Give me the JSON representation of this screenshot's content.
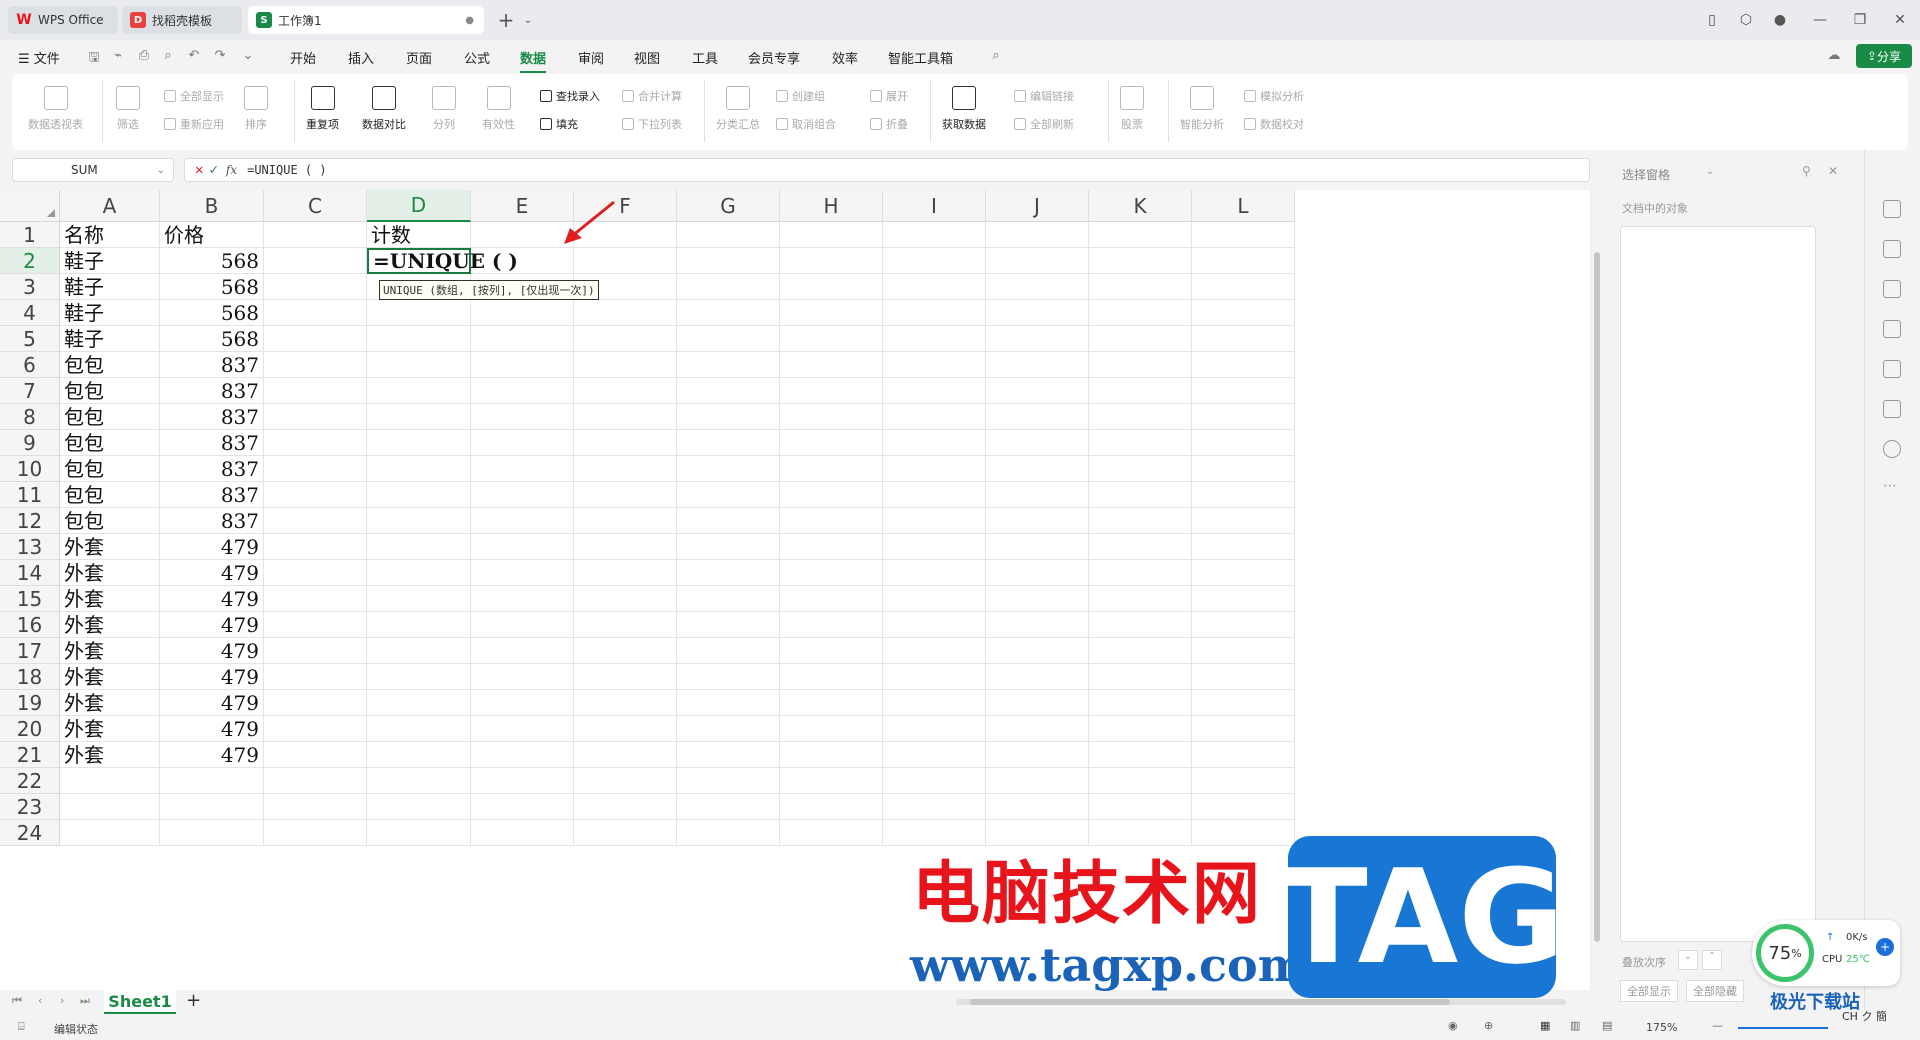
{
  "tabs": [
    {
      "label": "WPS Office",
      "icon": "wps-logo-icon",
      "color": "#e8141b"
    },
    {
      "label": "找稻壳模板",
      "icon": "docer-icon",
      "color": "#e8413f"
    },
    {
      "label": "工作簿1",
      "icon": "sheet-icon",
      "color": "#1a8b46"
    }
  ],
  "menu": {
    "file": "文件",
    "items": [
      "开始",
      "插入",
      "页面",
      "公式",
      "数据",
      "审阅",
      "视图",
      "工具",
      "会员专享",
      "效率",
      "智能工具箱"
    ],
    "active": "数据",
    "share": "分享"
  },
  "ribbon": {
    "pivot": "数据透视表",
    "filter": "筛选",
    "show_all": "全部显示",
    "reapply": "重新应用",
    "sort": "排序",
    "dup": "重复项",
    "compare": "数据对比",
    "split": "分列",
    "validity": "有效性",
    "lookup": "查找录入",
    "fill": "填充",
    "merge_calc": "合并计算",
    "dropdown": "下拉列表",
    "subtotal": "分类汇总",
    "group": "创建组",
    "ungroup": "取消组合",
    "expand": "展开",
    "collapse": "折叠",
    "get_data": "获取数据",
    "edit_links": "编辑链接",
    "refresh_all": "全部刷新",
    "stock": "股票",
    "smart": "智能分析",
    "simulate": "模拟分析",
    "verify": "数据校对"
  },
  "formula_bar": {
    "name_box": "SUM",
    "formula": "=UNIQUE ( )"
  },
  "grid": {
    "columns": [
      "A",
      "B",
      "C",
      "D",
      "E",
      "F",
      "G",
      "H",
      "I",
      "J",
      "K",
      "L"
    ],
    "selected_column": "D",
    "rows": [
      "1",
      "2",
      "3",
      "4",
      "5",
      "6",
      "7",
      "8",
      "9",
      "10",
      "11",
      "12",
      "13",
      "14",
      "15",
      "16",
      "17",
      "18",
      "19",
      "20",
      "21",
      "22",
      "23",
      "24"
    ],
    "selected_row": "2",
    "header": {
      "A": "名称",
      "B": "价格",
      "D": "计数"
    },
    "data": [
      [
        "鞋子",
        "568"
      ],
      [
        "鞋子",
        "568"
      ],
      [
        "鞋子",
        "568"
      ],
      [
        "鞋子",
        "568"
      ],
      [
        "包包",
        "837"
      ],
      [
        "包包",
        "837"
      ],
      [
        "包包",
        "837"
      ],
      [
        "包包",
        "837"
      ],
      [
        "包包",
        "837"
      ],
      [
        "包包",
        "837"
      ],
      [
        "包包",
        "837"
      ],
      [
        "外套",
        "479"
      ],
      [
        "外套",
        "479"
      ],
      [
        "外套",
        "479"
      ],
      [
        "外套",
        "479"
      ],
      [
        "外套",
        "479"
      ],
      [
        "外套",
        "479"
      ],
      [
        "外套",
        "479"
      ],
      [
        "外套",
        "479"
      ],
      [
        "外套",
        "479"
      ]
    ],
    "active_cell_text": "=UNIQUE ( )",
    "tooltip": "UNIQUE (数组, [按列], [仅出现一次])"
  },
  "sheets": {
    "tab": "Sheet1",
    "add": "+"
  },
  "status": {
    "mode": "编辑状态",
    "zoom": "175%"
  },
  "selection_pane": {
    "title": "选择窗格",
    "objects_label": "文档中的对象",
    "order_label": "叠放次序",
    "show_all": "全部显示",
    "hide_all": "全部隐藏"
  },
  "watermark": {
    "cn": "电脑技术网",
    "url": "www.tagxp.com",
    "tag": "TAG",
    "site": "极光下载站"
  },
  "cpu_widget": {
    "percent": "75",
    "unit": "%",
    "net": "0K/s",
    "cpu": "CPU",
    "temp": "25℃",
    "ime": "CH ク 簡"
  }
}
